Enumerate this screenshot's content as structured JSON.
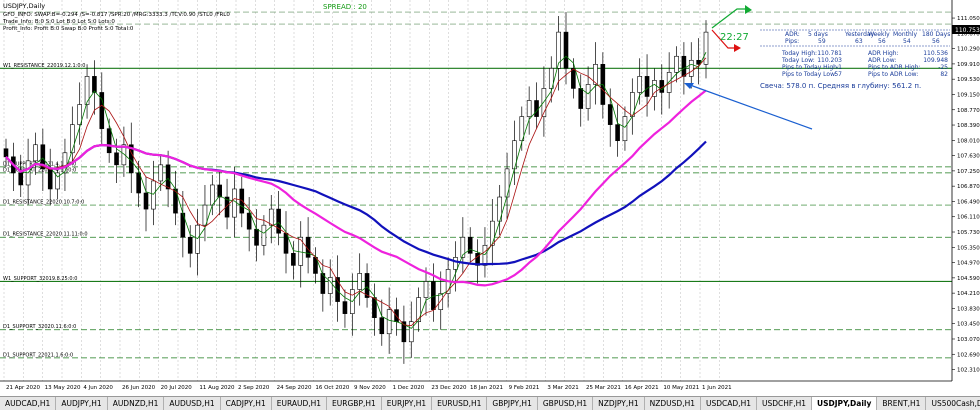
{
  "window_title": "USDJPY,Daily",
  "header_lines": [
    "GFO_INFO: SWAP:B=-0.294 /S=-0.817 /SPR:20 /MRG:3333.3 /TCV:0.90 /STL0 /FRL0",
    "Trade_Info: B:0 S:0 Lot B:0 Lot S:0 Lots:0",
    "Profit_Info: Profit B:0 Swap B:0 Profit S:0 Total:0"
  ],
  "spread_label": "SPREAD : 20",
  "timer": "22:27",
  "current_price": "110.753",
  "adr_table": {
    "headers": [
      "ADR:",
      "5 days",
      "Yesterday",
      "Weekly",
      "Monthly",
      "180 Days"
    ],
    "pips": [
      "Pips:",
      "59",
      "63",
      "56",
      "54",
      "56"
    ],
    "left_rows": [
      [
        "Today High:",
        "110.781"
      ],
      [
        "Today Low:",
        "110.203"
      ],
      [
        "Pips to Today High:",
        "-1"
      ],
      [
        "Pips to Today Low:",
        "57"
      ]
    ],
    "right_rows": [
      [
        "ADR High:",
        "110.536"
      ],
      [
        "ADR Low:",
        "109.948"
      ],
      [
        "Pips to ADR High:",
        "-25"
      ],
      [
        "Pips to ADR Low:",
        "82"
      ]
    ]
  },
  "candle_note": "Свеча: 578.0 п. Средняя в глубину: 561.2 п.",
  "level_labels": [
    {
      "text": "W1_RESISTANCE_22019.12.1:0:0",
      "price": 109.8
    },
    {
      "text": "D1_SUPPORT_22021.4.14:0:0",
      "price": 107.35
    },
    {
      "text": "D1_SUPPORT_22021.4.14:0:0",
      "price": 107.2
    },
    {
      "text": "D1_RESISTANCE_22020.10.7:0:0",
      "price": 106.4
    },
    {
      "text": "D1_RESISTANCE_22020.11.11:0:0",
      "price": 105.6
    },
    {
      "text": "W1_SUPPORT_32019.8.25:0:0",
      "price": 104.5
    },
    {
      "text": "D1_SUPPORT_32020.11.6:0:0",
      "price": 103.3
    },
    {
      "text": "D1_SUPPORT_22021.1.6:0:0",
      "price": 102.6
    }
  ],
  "price_axis": [
    "111.050",
    "110.670",
    "110.290",
    "109.910",
    "109.530",
    "109.150",
    "108.770",
    "108.390",
    "108.010",
    "107.630",
    "107.250",
    "106.870",
    "106.490",
    "106.110",
    "105.730",
    "105.350",
    "104.970",
    "104.590",
    "104.210",
    "103.830",
    "103.450",
    "103.070",
    "102.690",
    "102.310"
  ],
  "price_ticks": [
    111.05,
    110.67,
    110.29,
    109.91,
    109.53,
    109.15,
    108.77,
    108.39,
    108.01,
    107.63,
    107.25,
    106.87,
    106.49,
    106.11,
    105.73,
    105.35,
    104.97,
    104.59,
    104.21,
    103.83,
    103.45,
    103.07,
    102.69,
    102.31
  ],
  "time_axis": [
    "21 Apr 2020",
    "13 May 2020",
    "4 Jun 2020",
    "26 Jun 2020",
    "20 Jul 2020",
    "11 Aug 2020",
    "2 Sep 2020",
    "24 Sep 2020",
    "16 Oct 2020",
    "9 Nov 2020",
    "1 Dec 2020",
    "23 Dec 2020",
    "18 Jan 2021",
    "9 Feb 2021",
    "3 Mar 2021",
    "25 Mar 2021",
    "16 Apr 2021",
    "10 May 2021",
    "1 Jun 2021"
  ],
  "tabs": [
    "AUDCAD,H1",
    "AUDJPY,H1",
    "AUDNZD,H1",
    "AUDUSD,H1",
    "CADJPY,H1",
    "EURAUD,H1",
    "EURGBP,H1",
    "EURJPY,H1",
    "EURUSD,H1",
    "GBPJPY,H1",
    "GBPUSD,H1",
    "NZDJPY,H1",
    "NZDUSD,H1",
    "USDCAD,H1",
    "USDCHF,H1",
    "USDJPY,Daily",
    "BRENT,H1",
    "US500Cash,Daily",
    "XAUUSD,H1"
  ],
  "active_tab": "USDJPY,Daily",
  "colors": {
    "ma_fast": "#007700",
    "ma_mid": "#aa1111",
    "ma_200": "#1111bb",
    "ma_pink": "#ee22dd",
    "level_green": "#1a7a1a",
    "arrow_blue": "#1a5fd0",
    "arrow_red": "#dd1111",
    "arrow_green": "#11aa33"
  },
  "chart_data": {
    "type": "candlestick",
    "symbol": "USDJPY",
    "timeframe": "Daily",
    "ylim": [
      102.1,
      111.3
    ],
    "closes": [
      107.6,
      107.2,
      106.9,
      107.5,
      107.9,
      107.3,
      106.8,
      107.2,
      107.7,
      108.4,
      108.9,
      109.6,
      109.2,
      108.3,
      107.7,
      107.4,
      107.9,
      107.2,
      106.7,
      106.3,
      107.0,
      107.4,
      106.8,
      106.2,
      105.6,
      105.2,
      105.9,
      106.4,
      106.9,
      106.6,
      106.1,
      106.8,
      106.2,
      105.8,
      105.4,
      105.9,
      106.3,
      105.7,
      105.2,
      104.9,
      105.6,
      105.1,
      104.7,
      104.2,
      104.6,
      104.0,
      103.7,
      104.3,
      104.7,
      104.1,
      103.6,
      103.2,
      103.8,
      103.5,
      103.0,
      103.5,
      104.1,
      104.5,
      103.8,
      104.2,
      104.8,
      105.1,
      105.6,
      105.2,
      104.9,
      105.4,
      106.0,
      106.6,
      107.3,
      108.0,
      108.6,
      109.0,
      108.6,
      109.3,
      109.8,
      110.7,
      109.8,
      109.3,
      108.8,
      109.4,
      109.9,
      108.9,
      108.4,
      108.0,
      108.6,
      109.2,
      109.6,
      109.1,
      109.5,
      109.2,
      109.7,
      110.1,
      109.6,
      110.0,
      109.9,
      110.7
    ],
    "annotations": [
      "SPREAD : 20",
      "22:27",
      "Свеча: 578.0 п. Средняя в глубину: 561.2 п."
    ]
  },
  "tab_controls": [
    "◄",
    "►"
  ]
}
